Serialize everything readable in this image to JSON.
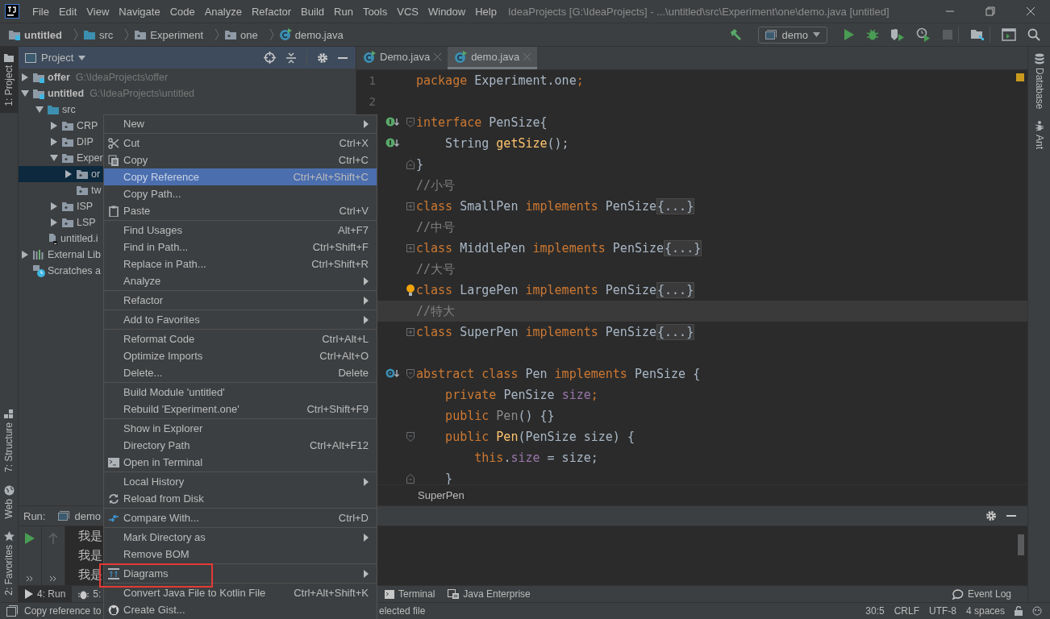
{
  "menubar": {
    "items": [
      "File",
      "Edit",
      "View",
      "Navigate",
      "Code",
      "Analyze",
      "Refactor",
      "Build",
      "Run",
      "Tools",
      "VCS",
      "Window",
      "Help"
    ],
    "title": "IdeaProjects [G:\\IdeaProjects] - ...\\untitled\\src\\Experiment\\one\\demo.java [untitled]"
  },
  "navbar": {
    "crumbs": [
      {
        "label": "untitled",
        "kind": "module",
        "bold": true
      },
      {
        "label": "src",
        "kind": "source",
        "bold": false
      },
      {
        "label": "Experiment",
        "kind": "package",
        "bold": false
      },
      {
        "label": "one",
        "kind": "package",
        "bold": false
      },
      {
        "label": "demo.java",
        "kind": "class",
        "bold": false
      }
    ],
    "run_config": "demo"
  },
  "left_strip": {
    "top": [
      {
        "label": "1: Project",
        "selected": true
      }
    ],
    "bottom": [
      {
        "label": "7: Structure",
        "selected": false,
        "kind": "structure"
      },
      {
        "label": "Web",
        "selected": false,
        "kind": "web"
      },
      {
        "label": "2: Favorites",
        "selected": false,
        "kind": "favorites"
      }
    ]
  },
  "right_strip": [
    {
      "label": "Database",
      "kind": "database"
    },
    {
      "label": "Ant",
      "kind": "ant"
    }
  ],
  "project": {
    "title": "Project",
    "tree": [
      {
        "label": "offer",
        "path": "G:\\IdeaProjects\\offer",
        "kind": "module",
        "bold": true,
        "expanded": false,
        "selected": false
      },
      {
        "label": "untitled",
        "path": "G:\\IdeaProjects\\untitled",
        "kind": "module",
        "bold": true,
        "expanded": true,
        "selected": false,
        "children": [
          {
            "label": "src",
            "kind": "source",
            "expanded": true,
            "selected": false,
            "children": [
              {
                "label": "CRP",
                "kind": "package",
                "expanded": false,
                "selected": false
              },
              {
                "label": "DIP",
                "kind": "package",
                "expanded": false,
                "selected": false
              },
              {
                "label": "Exper",
                "kind": "package",
                "expanded": true,
                "selected": false,
                "children": [
                  {
                    "label": "or",
                    "kind": "package",
                    "expanded": false,
                    "selected": true
                  },
                  {
                    "label": "tw",
                    "kind": "package",
                    "selected": false
                  }
                ]
              },
              {
                "label": "ISP",
                "kind": "package",
                "expanded": false,
                "selected": false
              },
              {
                "label": "LSP",
                "kind": "package",
                "expanded": false,
                "selected": false
              }
            ]
          },
          {
            "label": "untitled.i",
            "kind": "file",
            "selected": false
          }
        ]
      },
      {
        "label": "External Lib",
        "kind": "libraries",
        "expanded": false,
        "selected": false
      },
      {
        "label": "Scratches a",
        "kind": "scratches",
        "selected": false
      }
    ]
  },
  "editor": {
    "tabs": [
      {
        "label": "Demo.java",
        "selected": false
      },
      {
        "label": "demo.java",
        "selected": true
      }
    ],
    "lines": [
      {
        "number": "1",
        "tokens": [
          {
            "kind": "kw",
            "text": "package "
          },
          {
            "kind": "plain",
            "text": "Experiment.one"
          },
          {
            "kind": "kw",
            "text": ";"
          }
        ]
      },
      {
        "number": "2"
      },
      {
        "implemented": true,
        "fold_open": true,
        "tokens": [
          {
            "kind": "kw",
            "text": "interface "
          },
          {
            "kind": "plain",
            "text": "PenSize{"
          }
        ]
      },
      {
        "implemented": true,
        "tokens": [
          {
            "kind": "plain",
            "text": "    String "
          },
          {
            "kind": "fn",
            "text": "getSize"
          },
          {
            "kind": "plain",
            "text": "();"
          }
        ]
      },
      {
        "fold_close": true,
        "tokens": [
          {
            "kind": "plain",
            "text": "}"
          }
        ]
      },
      {
        "tokens": [
          {
            "kind": "comment",
            "text": "//小号"
          }
        ]
      },
      {
        "folded": true,
        "tokens": [
          {
            "kind": "kw",
            "text": "class "
          },
          {
            "kind": "plain",
            "text": "SmallPen "
          },
          {
            "kind": "kw",
            "text": "implements "
          },
          {
            "kind": "plain",
            "text": "PenSize"
          },
          {
            "kind": "folded",
            "text": "{...}"
          }
        ]
      },
      {
        "tokens": [
          {
            "kind": "comment",
            "text": "//中号"
          }
        ]
      },
      {
        "folded": true,
        "tokens": [
          {
            "kind": "kw",
            "text": "class "
          },
          {
            "kind": "plain",
            "text": "MiddlePen "
          },
          {
            "kind": "kw",
            "text": "implements "
          },
          {
            "kind": "plain",
            "text": "PenSize"
          },
          {
            "kind": "folded",
            "text": "{...}"
          }
        ]
      },
      {
        "tokens": [
          {
            "kind": "comment",
            "text": "//大号"
          }
        ]
      },
      {
        "bulb": true,
        "tokens": [
          {
            "kind": "kw",
            "text": "class "
          },
          {
            "kind": "plain",
            "text": "LargePen "
          },
          {
            "kind": "kw",
            "text": "implements "
          },
          {
            "kind": "plain",
            "text": "PenSize"
          },
          {
            "kind": "folded",
            "text": "{...}"
          }
        ]
      },
      {
        "current": true,
        "tokens": [
          {
            "kind": "comment",
            "text": "//特大"
          }
        ]
      },
      {
        "folded": true,
        "tokens": [
          {
            "kind": "kw",
            "text": "class "
          },
          {
            "kind": "plain",
            "text": "SuperPen "
          },
          {
            "kind": "kw",
            "text": "implements "
          },
          {
            "kind": "plain",
            "text": "PenSize"
          },
          {
            "kind": "folded",
            "text": "{...}"
          }
        ]
      },
      {
        "current": false
      },
      {
        "subclassed": true,
        "fold_open": true,
        "tokens": [
          {
            "kind": "kw",
            "text": "abstract class "
          },
          {
            "kind": "plain",
            "text": "Pen "
          },
          {
            "kind": "kw",
            "text": "implements "
          },
          {
            "kind": "plain",
            "text": "PenSize {"
          }
        ]
      },
      {
        "tokens": [
          {
            "kind": "kw",
            "text": "    private "
          },
          {
            "kind": "plain",
            "text": "PenSize "
          },
          {
            "kind": "field",
            "text": "size"
          },
          {
            "kind": "kw",
            "text": ";"
          }
        ]
      },
      {
        "tokens": [
          {
            "kind": "kw",
            "text": "    public "
          },
          {
            "kind": "muted",
            "text": "Pen"
          },
          {
            "kind": "plain",
            "text": "() {}"
          }
        ]
      },
      {
        "fold_open": true,
        "tokens": [
          {
            "kind": "kw",
            "text": "    public "
          },
          {
            "kind": "fn",
            "text": "Pen"
          },
          {
            "kind": "plain",
            "text": "(PenSize size) {"
          }
        ]
      },
      {
        "tokens": [
          {
            "kind": "kw",
            "text": "        this"
          },
          {
            "kind": "plain",
            "text": "."
          },
          {
            "kind": "field",
            "text": "size"
          },
          {
            "kind": "plain",
            "text": " = size;"
          }
        ]
      },
      {
        "fold_close": true,
        "tokens": [
          {
            "kind": "plain",
            "text": "    }"
          }
        ]
      }
    ],
    "breadcrumb": "SuperPen"
  },
  "run": {
    "label": "Run:",
    "tab": "demo",
    "output": [
      "我是",
      "我是",
      "我是"
    ]
  },
  "bottom_tabs": {
    "left": [
      {
        "label": "4: Run",
        "kind": "run",
        "selected": true
      },
      {
        "label": "5:",
        "kind": "debug",
        "selected": false
      }
    ],
    "right": [
      {
        "label": "Terminal",
        "kind": "terminal"
      },
      {
        "label": "Java Enterprise",
        "kind": "enterprise"
      }
    ],
    "event_log": "Event Log"
  },
  "status_bar": {
    "message_start": "Copy reference to",
    "message_end": "elected file",
    "position": "30:5",
    "line_separator": "CRLF",
    "encoding": "UTF-8",
    "indent": "4 spaces"
  },
  "context_menu": {
    "groups": [
      [
        {
          "label": "New",
          "submenu": true,
          "selected": false
        }
      ],
      [
        {
          "label": "Cut",
          "shortcut": "Ctrl+X",
          "kind": "scissors",
          "selected": false
        },
        {
          "label": "Copy",
          "shortcut": "Ctrl+C",
          "kind": "copy",
          "selected": false
        },
        {
          "label": "Copy Reference",
          "shortcut": "Ctrl+Alt+Shift+C",
          "selected": true
        },
        {
          "label": "Copy Path...",
          "selected": false
        },
        {
          "label": "Paste",
          "shortcut": "Ctrl+V",
          "kind": "paste",
          "selected": false
        }
      ],
      [
        {
          "label": "Find Usages",
          "shortcut": "Alt+F7",
          "selected": false
        },
        {
          "label": "Find in Path...",
          "shortcut": "Ctrl+Shift+F",
          "selected": false
        },
        {
          "label": "Replace in Path...",
          "shortcut": "Ctrl+Shift+R",
          "selected": false
        },
        {
          "label": "Analyze",
          "submenu": true,
          "selected": false
        }
      ],
      [
        {
          "label": "Refactor",
          "submenu": true,
          "selected": false
        }
      ],
      [
        {
          "label": "Add to Favorites",
          "submenu": true,
          "selected": false
        }
      ],
      [
        {
          "label": "Reformat Code",
          "shortcut": "Ctrl+Alt+L",
          "selected": false
        },
        {
          "label": "Optimize Imports",
          "shortcut": "Ctrl+Alt+O",
          "selected": false
        },
        {
          "label": "Delete...",
          "shortcut": "Delete",
          "selected": false
        }
      ],
      [
        {
          "label": "Build Module 'untitled'",
          "selected": false
        },
        {
          "label": "Rebuild 'Experiment.one'",
          "shortcut": "Ctrl+Shift+F9",
          "selected": false
        }
      ],
      [
        {
          "label": "Show in Explorer",
          "selected": false
        },
        {
          "label": "Directory Path",
          "shortcut": "Ctrl+Alt+F12",
          "selected": false
        },
        {
          "label": "Open in Terminal",
          "kind": "terminal",
          "selected": false
        }
      ],
      [
        {
          "label": "Local History",
          "submenu": true,
          "selected": false
        },
        {
          "label": "Reload from Disk",
          "kind": "reload",
          "selected": false
        }
      ],
      [
        {
          "label": "Compare With...",
          "shortcut": "Ctrl+D",
          "kind": "compare",
          "selected": false
        }
      ],
      [
        {
          "label": "Mark Directory as",
          "submenu": true,
          "selected": false
        },
        {
          "label": "Remove BOM",
          "selected": false
        }
      ],
      [
        {
          "label": "Diagrams",
          "submenu": true,
          "kind": "diagram",
          "highlighted": true,
          "selected": false
        }
      ],
      [
        {
          "label": "Convert Java File to Kotlin File",
          "shortcut": "Ctrl+Alt+Shift+K",
          "selected": false
        },
        {
          "label": "Create Gist...",
          "kind": "cat",
          "selected": false
        }
      ]
    ]
  }
}
